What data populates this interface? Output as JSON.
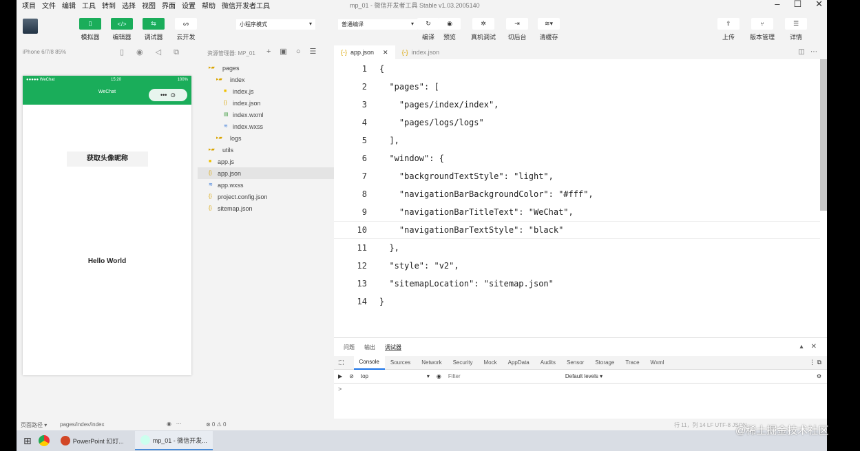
{
  "menu": [
    "项目",
    "文件",
    "编辑",
    "工具",
    "转到",
    "选择",
    "视图",
    "界面",
    "设置",
    "帮助",
    "微信开发者工具"
  ],
  "window_title": "mp_01 - 微信开发者工具 Stable v1.03.2005140",
  "toolbar": {
    "simulator": "模拟器",
    "editor": "编辑器",
    "debugger": "调试器",
    "cloud": "云开发",
    "mode": "小程序模式",
    "compile_mode": "普通编译",
    "compile": "编译",
    "preview": "预览",
    "remote_debug": "真机调试",
    "background": "切后台",
    "clear_cache": "清缓存",
    "upload": "上传",
    "version": "版本管理",
    "details": "详情"
  },
  "simulator": {
    "device": "iPhone 6/7/8 85%",
    "status_carrier": "●●●●● WeChat",
    "status_time": "15:20",
    "status_battery": "100%",
    "nav_title": "WeChat",
    "button": "获取头像昵称",
    "hello": "Hello World"
  },
  "explorer": {
    "title": "资源管理器: MP_01",
    "items": [
      {
        "label": "pages",
        "type": "folder",
        "depth": 0
      },
      {
        "label": "index",
        "type": "folder",
        "depth": 1
      },
      {
        "label": "index.js",
        "type": "js",
        "depth": 2
      },
      {
        "label": "index.json",
        "type": "json",
        "depth": 2
      },
      {
        "label": "index.wxml",
        "type": "wxml",
        "depth": 2
      },
      {
        "label": "index.wxss",
        "type": "wxss",
        "depth": 2
      },
      {
        "label": "logs",
        "type": "folder",
        "depth": 1
      },
      {
        "label": "utils",
        "type": "folder",
        "depth": 0
      },
      {
        "label": "app.js",
        "type": "js",
        "depth": 0
      },
      {
        "label": "app.json",
        "type": "json",
        "depth": 0
      },
      {
        "label": "app.wxss",
        "type": "wxss",
        "depth": 0
      },
      {
        "label": "project.config.json",
        "type": "json",
        "depth": 0
      },
      {
        "label": "sitemap.json",
        "type": "json",
        "depth": 0
      }
    ]
  },
  "editor": {
    "tabs": [
      "app.json",
      "index.json"
    ],
    "lines": [
      "{",
      "  \"pages\": [",
      "    \"pages/index/index\",",
      "    \"pages/logs/logs\"",
      "  ],",
      "  \"window\": {",
      "    \"backgroundTextStyle\": \"light\",",
      "    \"navigationBarBackgroundColor\": \"#fff\",",
      "    \"navigationBarTitleText\": \"WeChat\",",
      "    \"navigationBarTextStyle\": \"black\"",
      "  },",
      "  \"style\": \"v2\",",
      "  \"sitemapLocation\": \"sitemap.json\"",
      "}"
    ]
  },
  "devtools": {
    "panels": [
      "问题",
      "输出",
      "调试器"
    ],
    "tabs": [
      "Console",
      "Sources",
      "Network",
      "Security",
      "Mock",
      "AppData",
      "Audits",
      "Sensor",
      "Storage",
      "Trace",
      "Wxml"
    ],
    "context": "top",
    "filter_placeholder": "Filter",
    "levels": "Default levels ▾",
    "prompt": ">"
  },
  "status": {
    "path_label": "页面路径 ▾",
    "path": "pages/index/index",
    "errors": "⊗ 0 ⚠ 0",
    "right": "行 11，列 14  LF  UTF-8  JSON"
  },
  "taskbar": {
    "items": [
      "PowerPoint 幻灯...",
      "mp_01 - 微信开发..."
    ]
  },
  "watermark": "@稀土掘金技术社区",
  "colors": {
    "accent": "#1aad5a"
  }
}
